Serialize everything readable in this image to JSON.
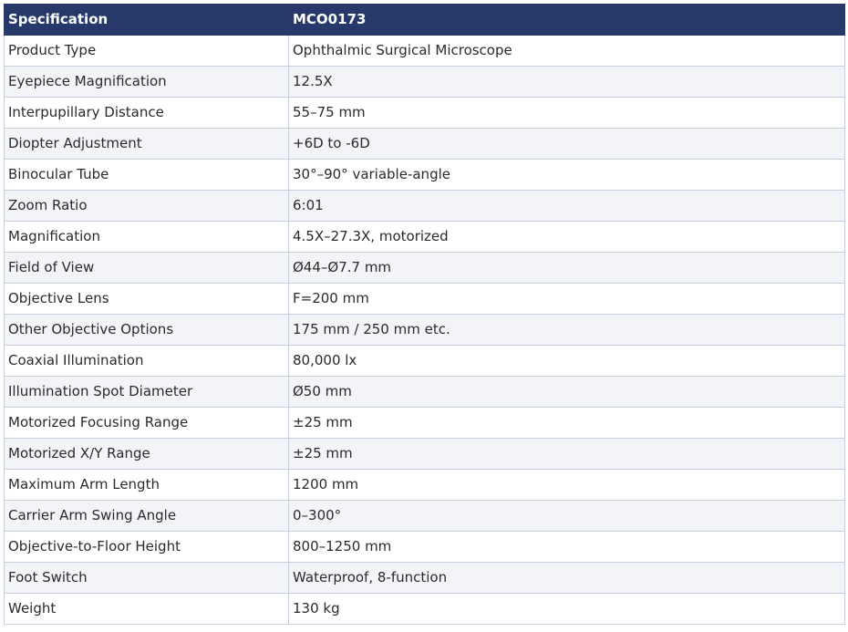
{
  "table": {
    "header": [
      "Specification",
      "MCO0173"
    ],
    "rows": [
      [
        "Product Type",
        "Ophthalmic Surgical Microscope"
      ],
      [
        "Eyepiece Magnification",
        "12.5X"
      ],
      [
        "Interpupillary Distance",
        "55–75 mm"
      ],
      [
        "Diopter Adjustment",
        "+6D to -6D"
      ],
      [
        "Binocular Tube",
        "30°–90° variable-angle"
      ],
      [
        "Zoom Ratio",
        "6:01"
      ],
      [
        "Magnification",
        "4.5X–27.3X, motorized"
      ],
      [
        "Field of View",
        "Ø44–Ø7.7 mm"
      ],
      [
        "Objective Lens",
        "F=200 mm"
      ],
      [
        "Other Objective Options",
        "175 mm / 250 mm etc."
      ],
      [
        "Coaxial Illumination",
        "80,000 lx"
      ],
      [
        "Illumination Spot Diameter",
        "Ø50 mm"
      ],
      [
        "Motorized Focusing Range",
        "±25 mm"
      ],
      [
        "Motorized X/Y Range",
        "±25 mm"
      ],
      [
        "Maximum Arm Length",
        "1200 mm"
      ],
      [
        "Carrier Arm Swing Angle",
        "0–300°"
      ],
      [
        "Objective-to-Floor Height",
        "800–1250 mm"
      ],
      [
        "Foot Switch",
        "Waterproof, 8-function"
      ],
      [
        "Weight",
        "130 kg"
      ]
    ]
  },
  "colors": {
    "header_bg": "#27386a",
    "header_text": "#ffffff",
    "row_alt_bg": "#f3f4f7",
    "border": "#c8cedd"
  }
}
